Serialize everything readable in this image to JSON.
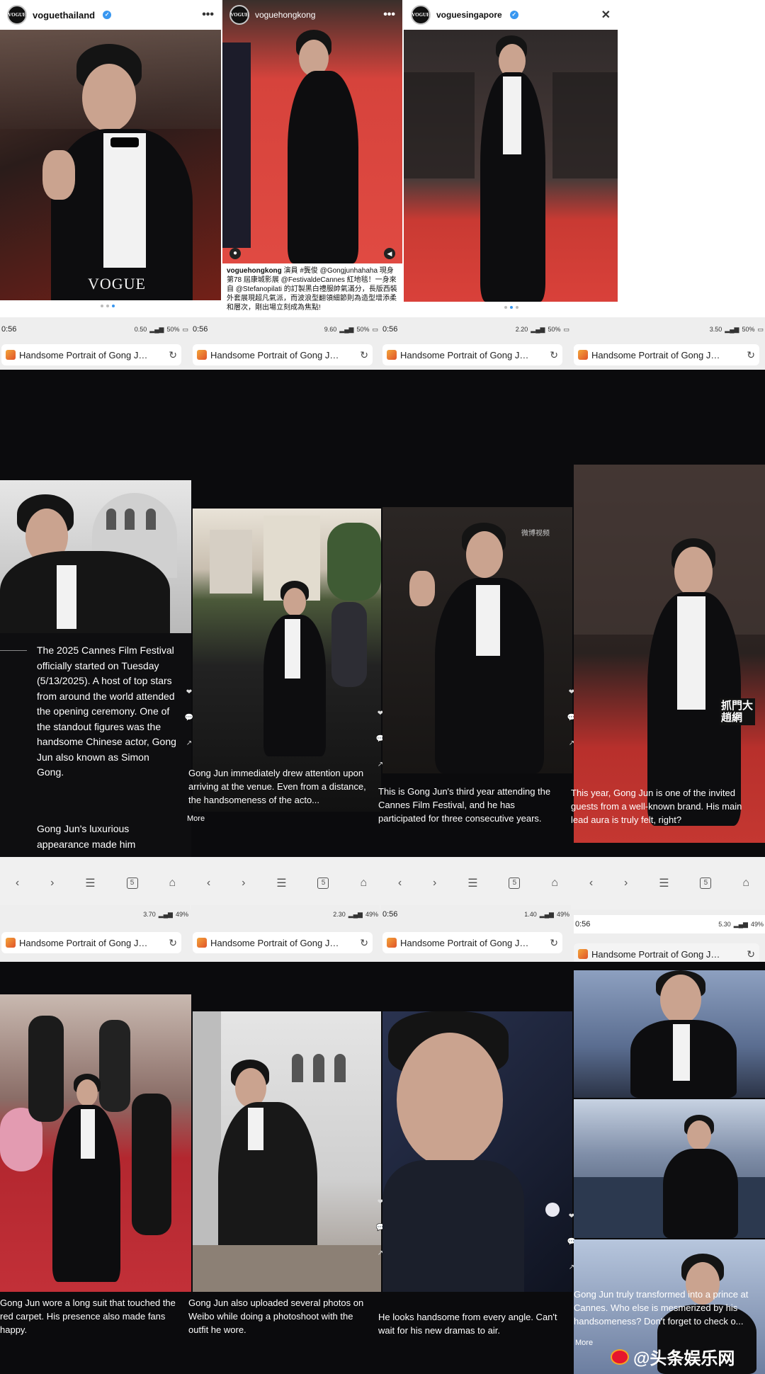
{
  "top_row": {
    "panels": [
      {
        "account": "voguethailand",
        "logo_text": "VOGUE",
        "watermark": "VOGUE"
      },
      {
        "account": "voguehongkong",
        "logo_text": "VOGUE",
        "caption_account": "voguehongkong",
        "caption": "演員 #龔俊 @Gongjunhahaha 現身第78 屆康城影展 @FestivaldeCannes 紅地毯！一身來自 @Stefanopilati 的訂製黑白禮服帥氣滿分，長版西裝外套展現超凡氣派，而波浪型翻領細節則為造型增添柔和層次，剛出場立刻成為焦點!"
      },
      {
        "account": "voguesingapore",
        "logo_text": "VOGUE"
      }
    ]
  },
  "browser": {
    "tab_title": "Handsome Portrait of Gong J…",
    "reload_icon": "↻",
    "more_label": "More",
    "status_rows": [
      {
        "time": "0:56",
        "battery": "50%",
        "speed": "0.50"
      },
      {
        "time": "0:56",
        "battery": "50%",
        "speed": "9.60"
      },
      {
        "time": "0:56",
        "battery": "50%",
        "speed": "2.20"
      },
      {
        "time": "",
        "battery": "50%",
        "speed": "3.50"
      }
    ],
    "status_rows_2": [
      {
        "time": "",
        "battery": "49%",
        "speed": "3.70"
      },
      {
        "time": "",
        "battery": "49%",
        "speed": "2.30"
      },
      {
        "time": "0:56",
        "battery": "49%",
        "speed": "1.40"
      },
      {
        "time": "0:56",
        "battery": "49%",
        "speed": "5.30"
      }
    ]
  },
  "middle_row": {
    "text_block": "The 2025 Cannes Film Festival officially started on Tuesday (5/13/2025). A host of top stars from around the world attended the opening ceremony. One of the standout figures was the handsome Chinese actor, Gong Jun also known as Simon Gong.",
    "text_block_2": "Gong Jun's luxurious appearance made him",
    "captions": [
      "Gong Jun immediately drew attention upon arriving at the venue. Even from a distance, the handsomeness of the acto...",
      "This is Gong Jun's third year attending the Cannes Film Festival, and he has participated for three consecutive years.",
      "This year, Gong Jun is one of the invited guests from a well-known brand. His main lead aura is truly felt, right?"
    ],
    "overlay_badge": "抓門大趙網"
  },
  "bottom_row": {
    "captions": [
      "Gong Jun wore a long suit that touched the red carpet. His presence also made fans happy.",
      "Gong Jun also uploaded several photos on Weibo while doing a photoshoot with the outfit he wore.",
      "He looks handsome from every angle. Can't wait for his new dramas to air.",
      "Gong Jun truly transformed into a prince at Cannes. Who else is mesmerized by his handsomeness? Don't forget to check o..."
    ]
  },
  "watermark": "@头条娱乐网",
  "weibo_mark": "微博视频"
}
